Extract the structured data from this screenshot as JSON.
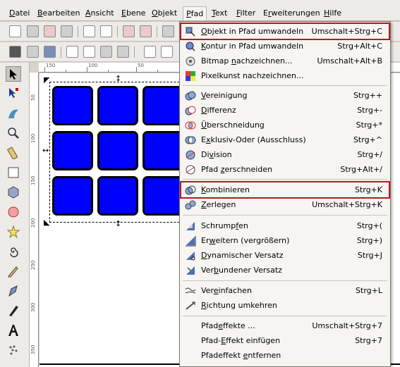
{
  "menubar": [
    {
      "pre": "",
      "ul": "D",
      "post": "atei"
    },
    {
      "pre": "",
      "ul": "B",
      "post": "earbeiten"
    },
    {
      "pre": "",
      "ul": "A",
      "post": "nsicht"
    },
    {
      "pre": "",
      "ul": "E",
      "post": "bene"
    },
    {
      "pre": "",
      "ul": "O",
      "post": "bjekt"
    },
    {
      "pre": "",
      "ul": "P",
      "post": "fad"
    },
    {
      "pre": "",
      "ul": "T",
      "post": "ext"
    },
    {
      "pre": "",
      "ul": "F",
      "post": "ilter"
    },
    {
      "pre": "E",
      "ul": "r",
      "post": "weiterungen"
    },
    {
      "pre": "",
      "ul": "H",
      "post": "ilfe"
    }
  ],
  "ruler": {
    "h_labels": [
      "150",
      "100",
      "50"
    ],
    "v_labels": [
      "50",
      "100",
      "150",
      "200",
      "250",
      "300",
      "350"
    ]
  },
  "menu": {
    "items": [
      {
        "pre": "",
        "ul": "O",
        "post": "bjekt in Pfad umwandeln",
        "shortcut": "Umschalt+Strg+C",
        "icon": "object-to-path-icon"
      },
      {
        "pre": "",
        "ul": "K",
        "post": "ontur in Pfad umwandeln",
        "shortcut": "Strg+Alt+C",
        "icon": "stroke-to-path-icon"
      },
      {
        "pre": "Bitmap ",
        "ul": "n",
        "post": "achzeichnen...",
        "shortcut": "Umschalt+Alt+B",
        "icon": "trace-bitmap-icon"
      },
      {
        "pre": "Pixelkunst nachzeichnen...",
        "ul": "",
        "post": "",
        "shortcut": "",
        "icon": "trace-pixel-art-icon"
      },
      {
        "pre": "",
        "ul": "V",
        "post": "ereinigung",
        "shortcut": "Strg++",
        "icon": "union-icon"
      },
      {
        "pre": "",
        "ul": "D",
        "post": "ifferenz",
        "shortcut": "Strg+-",
        "icon": "difference-icon"
      },
      {
        "pre": "",
        "ul": "Ü",
        "post": "berschneidung",
        "shortcut": "Strg+*",
        "icon": "intersection-icon"
      },
      {
        "pre": "E",
        "ul": "x",
        "post": "klusiv-Oder (Ausschluss)",
        "shortcut": "Strg+^",
        "icon": "exclusion-icon"
      },
      {
        "pre": "Di",
        "ul": "v",
        "post": "ision",
        "shortcut": "Strg+/",
        "icon": "division-icon"
      },
      {
        "pre": "Pfad ",
        "ul": "z",
        "post": "erschneiden",
        "shortcut": "Strg+Alt+/",
        "icon": "cut-path-icon"
      },
      {
        "pre": "",
        "ul": "K",
        "post": "ombinieren",
        "shortcut": "Strg+K",
        "icon": "combine-icon"
      },
      {
        "pre": "",
        "ul": "Z",
        "post": "erlegen",
        "shortcut": "Umschalt+Strg+K",
        "icon": "break-apart-icon"
      },
      {
        "pre": "Schrump",
        "ul": "f",
        "post": "en",
        "shortcut": "Strg+(",
        "icon": "inset-icon"
      },
      {
        "pre": "Er",
        "ul": "w",
        "post": "eitern (vergrößern)",
        "shortcut": "Strg+)",
        "icon": "outset-icon"
      },
      {
        "pre": "",
        "ul": "D",
        "post": "ynamischer Versatz",
        "shortcut": "Strg+J",
        "icon": "dynamic-offset-icon"
      },
      {
        "pre": "Ver",
        "ul": "b",
        "post": "undener Versatz",
        "shortcut": "",
        "icon": "linked-offset-icon"
      },
      {
        "pre": "Ver",
        "ul": "e",
        "post": "infachen",
        "shortcut": "Strg+L",
        "icon": "simplify-icon"
      },
      {
        "pre": "",
        "ul": "R",
        "post": "ichtung umkehren",
        "shortcut": "",
        "icon": "reverse-icon"
      },
      {
        "pre": "Pfad",
        "ul": "e",
        "post": "ffekte ...",
        "shortcut": "Umschalt+Strg+7",
        "icon": ""
      },
      {
        "pre": "Pfad-",
        "ul": "E",
        "post": "ffekt einfügen",
        "shortcut": "Strg+7",
        "icon": ""
      },
      {
        "pre": "Pfadeffekt ",
        "ul": "e",
        "post": "ntfernen",
        "shortcut": "",
        "icon": ""
      }
    ]
  },
  "colors": {
    "accent_highlight": "#c0141c",
    "tile_fill": "#0000ff",
    "menu_bg": "#f6f5f2"
  }
}
